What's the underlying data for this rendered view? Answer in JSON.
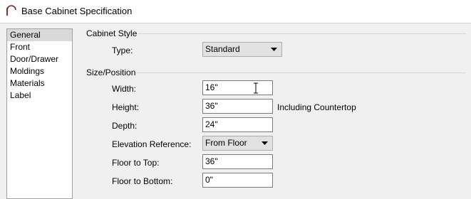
{
  "window": {
    "title": "Base Cabinet Specification",
    "icon": "arch-icon"
  },
  "sidebar": {
    "items": [
      {
        "label": "General",
        "selected": true
      },
      {
        "label": "Front",
        "selected": false
      },
      {
        "label": "Door/Drawer",
        "selected": false
      },
      {
        "label": "Moldings",
        "selected": false
      },
      {
        "label": "Materials",
        "selected": false
      },
      {
        "label": "Label",
        "selected": false
      }
    ]
  },
  "cabinet_style": {
    "heading": "Cabinet Style",
    "type_label": "Type:",
    "type_value": "Standard"
  },
  "size_position": {
    "heading": "Size/Position",
    "width": {
      "label": "Width:",
      "value": "16\""
    },
    "height": {
      "label": "Height:",
      "value": "36\"",
      "suffix": "Including Countertop"
    },
    "depth": {
      "label": "Depth:",
      "value": "24\""
    },
    "elevation_reference": {
      "label": "Elevation Reference:",
      "value": "From Floor"
    },
    "floor_to_top": {
      "label": "Floor to Top:",
      "value": "36\""
    },
    "floor_to_bottom": {
      "label": "Floor to Bottom:",
      "value": "0\""
    }
  }
}
